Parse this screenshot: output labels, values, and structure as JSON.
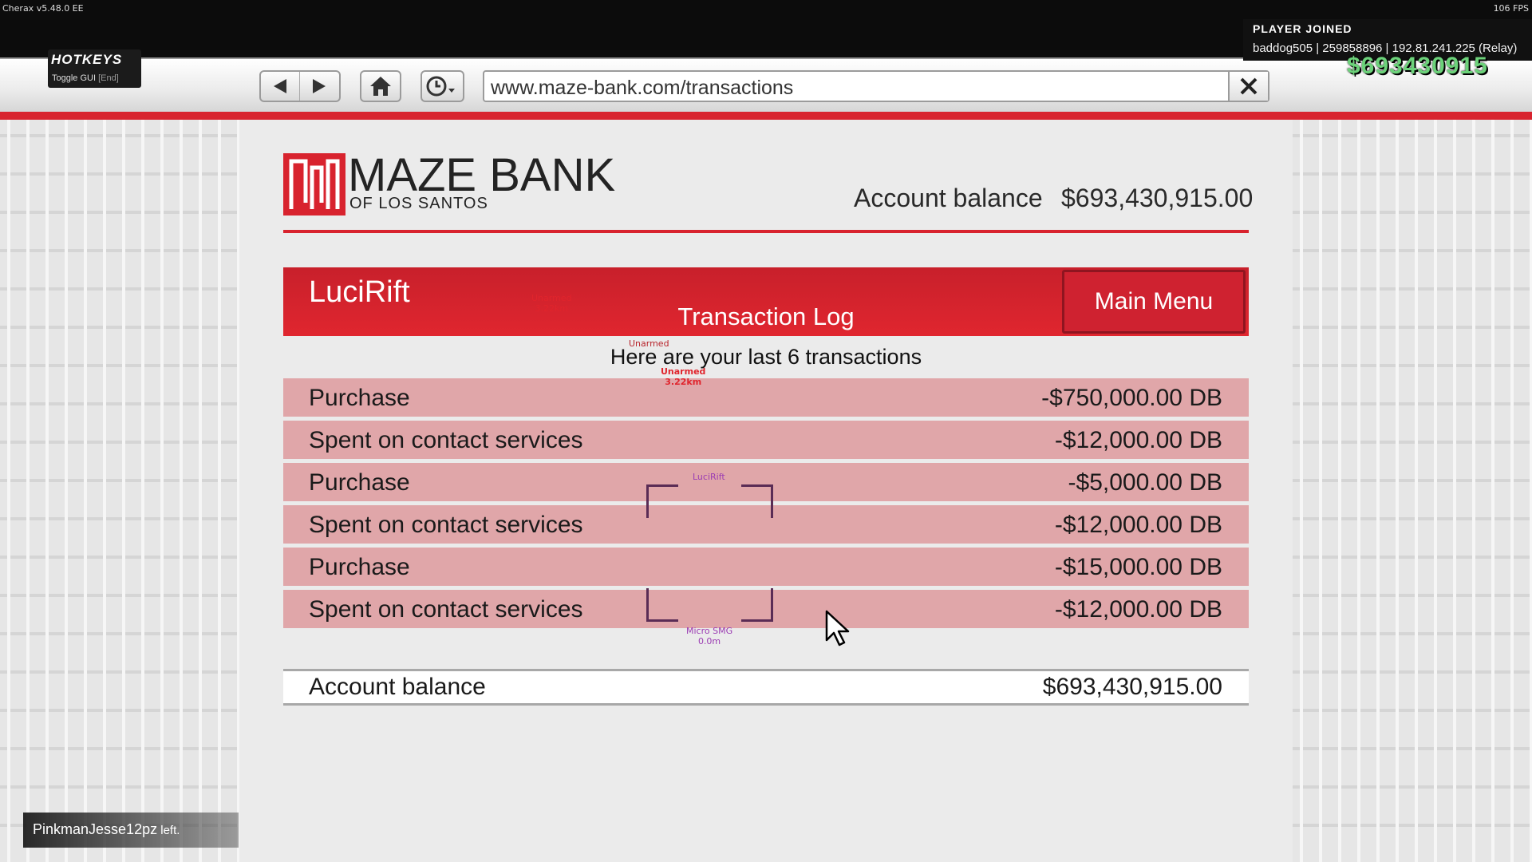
{
  "overlay": {
    "title": "Cherax v5.48.0 EE",
    "fps": "106 FPS",
    "hotkeys_title": "HOTKEYS",
    "hotkeys_toggle": "Toggle GUI",
    "hotkeys_key": "[End]",
    "notification_title": "PLAYER JOINED",
    "notification_body": "baddog505 | 259858896 | 192.81.241.225 (Relay)",
    "money_hud": "$693430915",
    "left_message_name": "PinkmanJesse12pz",
    "left_message_suffix": " left."
  },
  "browser": {
    "url": "www.maze-bank.com/transactions"
  },
  "bank": {
    "name": "MAZE BANK",
    "subtitle": "OF LOS SANTOS",
    "balance_label": "Account balance",
    "balance_value": "$693,430,915.00",
    "username": "LuciRift",
    "log_title": "Transaction Log",
    "main_menu_label": "Main Menu",
    "summary": "Here are your last 6 transactions",
    "transactions": [
      {
        "desc": "Purchase",
        "amount": "-$750,000.00 DB"
      },
      {
        "desc": "Spent on contact services",
        "amount": "-$12,000.00 DB"
      },
      {
        "desc": "Purchase",
        "amount": "-$5,000.00 DB"
      },
      {
        "desc": "Spent on contact services",
        "amount": "-$12,000.00 DB"
      },
      {
        "desc": "Purchase",
        "amount": "-$15,000.00 DB"
      },
      {
        "desc": "Spent on contact services",
        "amount": "-$12,000.00 DB"
      }
    ],
    "footer_label": "Account balance",
    "footer_value": "$693,430,915.00"
  },
  "esp_tags": {
    "tag1_weapon": "Unarmed",
    "tag1_dist": "3.22km",
    "tag2_weapon": "Unarmed",
    "tag3_weapon": "Unarmed",
    "tag3_dist": "3.22km",
    "self_name": "LuciRift",
    "self_weapon": "Micro SMG",
    "self_dist": "0.0m"
  },
  "colors": {
    "brand_red": "#d8232e",
    "row_pink": "#e0a6a9",
    "hud_green": "#6cd27a"
  }
}
